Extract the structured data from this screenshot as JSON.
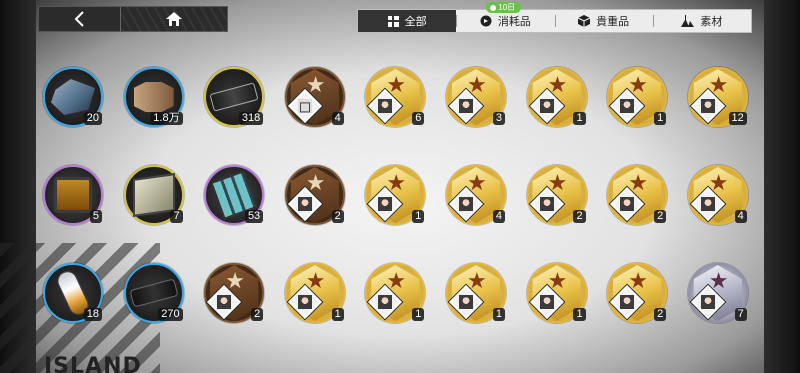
{
  "top_nav": {
    "back_icon": "chevron-left-icon",
    "home_icon": "home-icon"
  },
  "tabs": [
    {
      "id": "all",
      "label": "全部",
      "icon": "grid-icon",
      "active": true
    },
    {
      "id": "consumables",
      "label": "消耗品",
      "icon": "clock-tag-icon",
      "active": false,
      "badge": "10日"
    },
    {
      "id": "valuables",
      "label": "貴重品",
      "icon": "cube-icon",
      "active": false
    },
    {
      "id": "materials",
      "label": "素材",
      "icon": "flask-icon",
      "active": false
    }
  ],
  "colors": {
    "active_tab_bg": "#333333",
    "badge_green": "#6cc04a",
    "ring_blue": "#3aa7e4",
    "ring_yellow": "#d7c338",
    "ring_purple": "#b67ad8",
    "token_gold": "#e6b52f",
    "token_bronze": "#7a5530",
    "token_silver": "#9292a8"
  },
  "items": [
    {
      "kind": "material",
      "rarity": "blue",
      "art": "shards",
      "count": "20"
    },
    {
      "kind": "material",
      "rarity": "blue",
      "art": "bolt",
      "count": "1.8万"
    },
    {
      "kind": "material",
      "rarity": "yellow",
      "art": "chip",
      "count": "318"
    },
    {
      "kind": "token",
      "rarity": "bronze",
      "portrait": "empty",
      "count": "4"
    },
    {
      "kind": "token",
      "rarity": "gold",
      "portrait": "character",
      "count": "6"
    },
    {
      "kind": "token",
      "rarity": "gold",
      "portrait": "character",
      "count": "3"
    },
    {
      "kind": "token",
      "rarity": "gold",
      "portrait": "character",
      "count": "1"
    },
    {
      "kind": "token",
      "rarity": "gold",
      "portrait": "character",
      "count": "1"
    },
    {
      "kind": "token",
      "rarity": "gold",
      "portrait": "character",
      "count": "12"
    },
    {
      "kind": "material",
      "rarity": "purple",
      "art": "jar",
      "count": "5"
    },
    {
      "kind": "material",
      "rarity": "yellow",
      "art": "box",
      "count": "7"
    },
    {
      "kind": "material",
      "rarity": "purple",
      "art": "cells",
      "count": "53"
    },
    {
      "kind": "token",
      "rarity": "bronze",
      "portrait": "character",
      "count": "2"
    },
    {
      "kind": "token",
      "rarity": "gold",
      "portrait": "character",
      "count": "1"
    },
    {
      "kind": "token",
      "rarity": "gold",
      "portrait": "character",
      "count": "4"
    },
    {
      "kind": "token",
      "rarity": "gold",
      "portrait": "character",
      "count": "2"
    },
    {
      "kind": "token",
      "rarity": "gold",
      "portrait": "character",
      "count": "2"
    },
    {
      "kind": "token",
      "rarity": "gold",
      "portrait": "character",
      "count": "4"
    },
    {
      "kind": "material",
      "rarity": "blue",
      "art": "capsule",
      "count": "18"
    },
    {
      "kind": "material",
      "rarity": "blue",
      "art": "battery",
      "count": "270"
    },
    {
      "kind": "token",
      "rarity": "bronze",
      "portrait": "character",
      "count": "2"
    },
    {
      "kind": "token",
      "rarity": "gold",
      "portrait": "character",
      "count": "1"
    },
    {
      "kind": "token",
      "rarity": "gold",
      "portrait": "character",
      "count": "1"
    },
    {
      "kind": "token",
      "rarity": "gold",
      "portrait": "character",
      "count": "1"
    },
    {
      "kind": "token",
      "rarity": "gold",
      "portrait": "character",
      "count": "1"
    },
    {
      "kind": "token",
      "rarity": "gold",
      "portrait": "character",
      "count": "2"
    },
    {
      "kind": "token",
      "rarity": "silver",
      "portrait": "character",
      "count": "7"
    }
  ],
  "background_text": "ISLAND"
}
